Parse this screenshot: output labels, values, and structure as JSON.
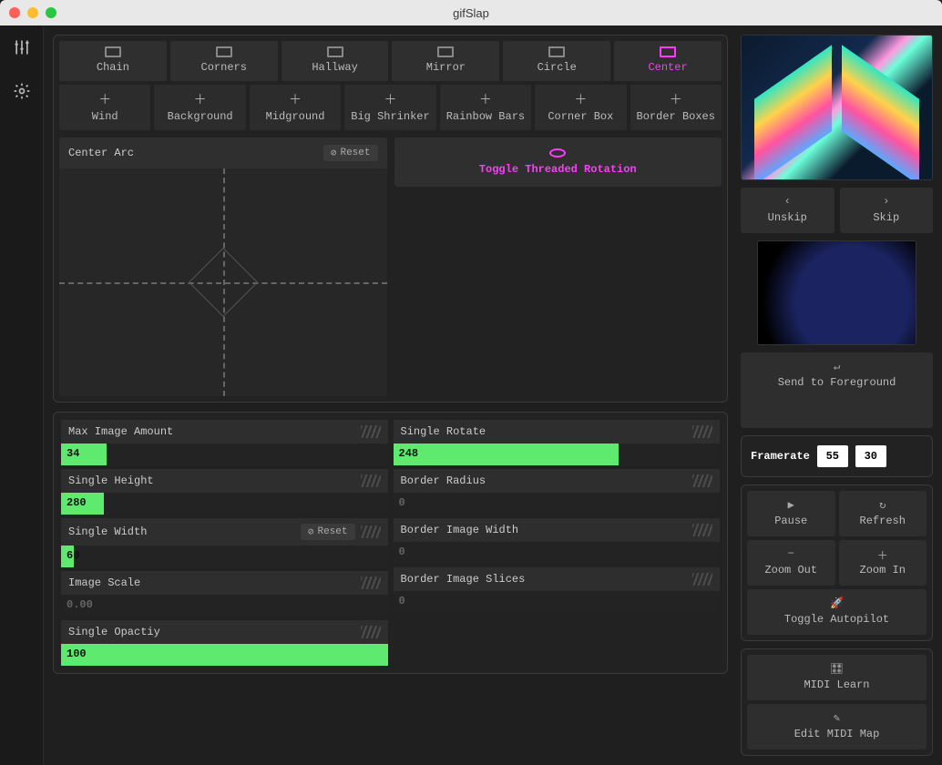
{
  "window": {
    "title": "gifSlap"
  },
  "tabs": [
    {
      "label": "Chain",
      "active": false
    },
    {
      "label": "Corners",
      "active": false
    },
    {
      "label": "Hallway",
      "active": false
    },
    {
      "label": "Mirror",
      "active": false
    },
    {
      "label": "Circle",
      "active": false
    },
    {
      "label": "Center",
      "active": true
    }
  ],
  "addons": [
    {
      "label": "Wind"
    },
    {
      "label": "Background"
    },
    {
      "label": "Midground"
    },
    {
      "label": "Big Shrinker"
    },
    {
      "label": "Rainbow Bars"
    },
    {
      "label": "Corner Box"
    },
    {
      "label": "Border Boxes"
    }
  ],
  "arc": {
    "title": "Center Arc",
    "reset": "Reset"
  },
  "toggle": {
    "label": "Toggle Threaded Rotation"
  },
  "sliders_left": [
    {
      "label": "Max Image Amount",
      "value": "34",
      "pct": 14,
      "reset": null
    },
    {
      "label": "Single Height",
      "value": "280",
      "pct": 13,
      "reset": null
    },
    {
      "label": "Single Width",
      "value": "60",
      "pct": 4,
      "reset": "Reset"
    },
    {
      "label": "Image Scale",
      "value": "0.00",
      "pct": 0,
      "reset": null
    },
    {
      "label": "Single Opactiy",
      "value": "100",
      "pct": 100,
      "reset": null
    }
  ],
  "sliders_right": [
    {
      "label": "Single Rotate",
      "value": "248",
      "pct": 69
    },
    {
      "label": "Border Radius",
      "value": "0",
      "pct": 0
    },
    {
      "label": "Border Image Width",
      "value": "0",
      "pct": 0
    },
    {
      "label": "Border Image Slices",
      "value": "0",
      "pct": 0
    }
  ],
  "right": {
    "unskip": "Unskip",
    "skip": "Skip",
    "send_fg": "Send to Foreground",
    "framerate_label": "Framerate",
    "framerate_actual": "55",
    "framerate_target": "30",
    "pause": "Pause",
    "refresh": "Refresh",
    "zoom_out": "Zoom Out",
    "zoom_in": "Zoom In",
    "autopilot": "Toggle Autopilot",
    "midi_learn": "MIDI Learn",
    "midi_map": "Edit MIDI Map"
  }
}
